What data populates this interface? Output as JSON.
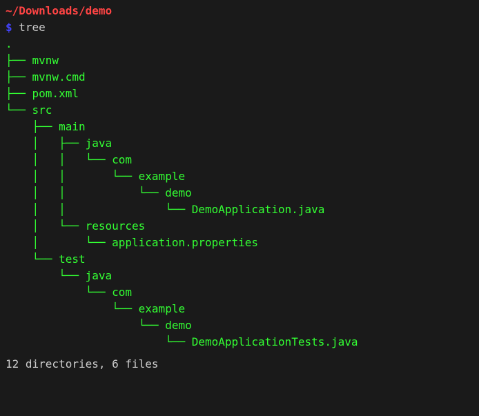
{
  "prompt_path": "~/Downloads/demo",
  "prompt_symbol": "$",
  "command": "tree",
  "tree_lines": [
    ".",
    "├── mvnw",
    "├── mvnw.cmd",
    "├── pom.xml",
    "└── src",
    "    ├── main",
    "    │   ├── java",
    "    │   │   └── com",
    "    │   │       └── example",
    "    │   │           └── demo",
    "    │   │               └── DemoApplication.java",
    "    │   └── resources",
    "    │       └── application.properties",
    "    └── test",
    "        └── java",
    "            └── com",
    "                └── example",
    "                    └── demo",
    "                        └── DemoApplicationTests.java"
  ],
  "summary": "12 directories, 6 files"
}
